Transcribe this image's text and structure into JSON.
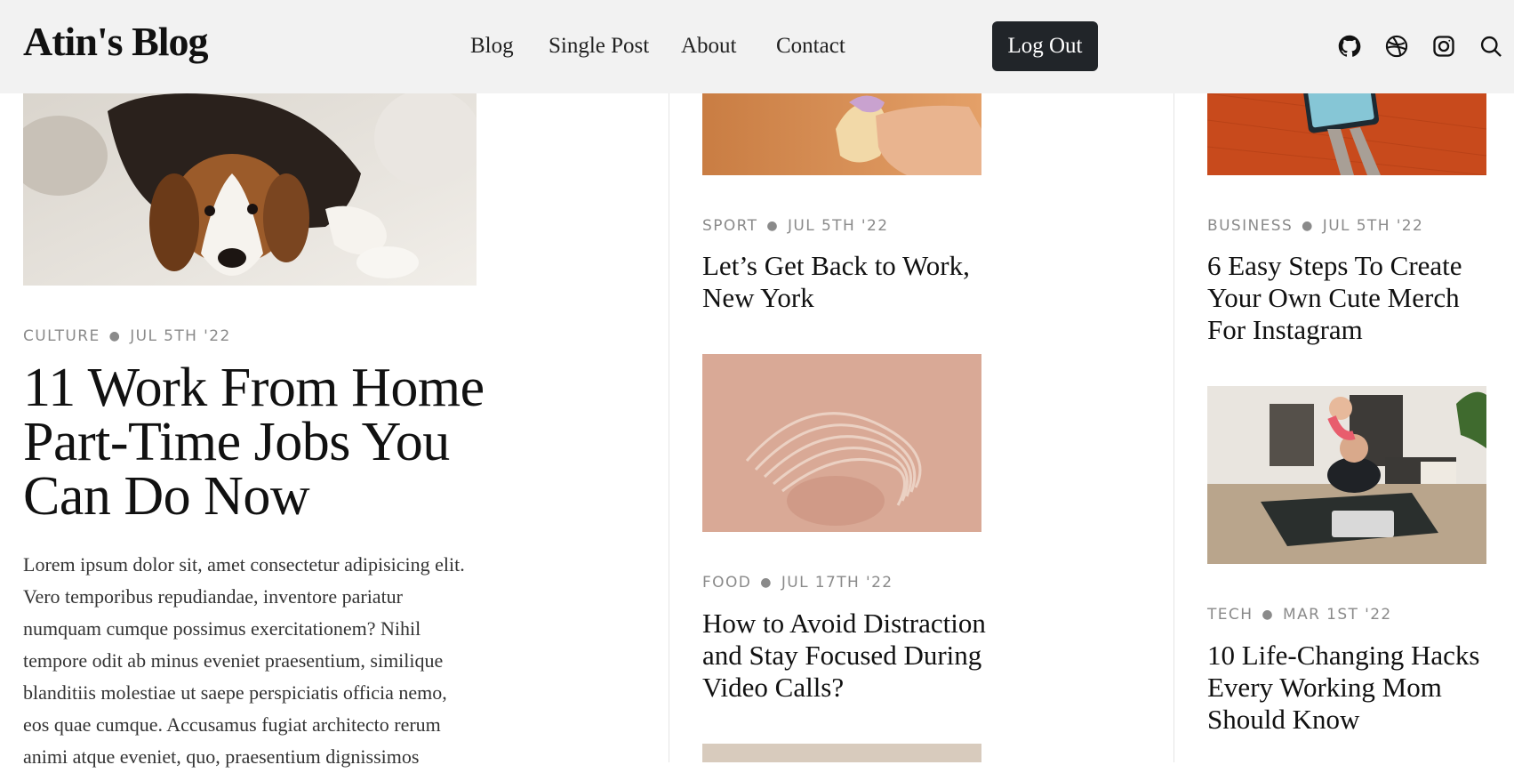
{
  "brand": "Atin's Blog",
  "nav": {
    "items": [
      "Blog",
      "Single Post",
      "About",
      "Contact"
    ],
    "logout_label": "Log Out"
  },
  "icons": [
    "github-icon",
    "dribbble-icon",
    "instagram-icon",
    "search-icon"
  ],
  "colors": {
    "header_bg": "#f2f2f2",
    "button_bg": "#212529",
    "meta_text": "#8a8a8a"
  },
  "featured": {
    "category": "CULTURE",
    "date": "JUL 5TH '22",
    "title": "11 Work From Home Part-Time Jobs You Can Do Now",
    "excerpt": "Lorem ipsum dolor sit, amet consectetur adipisicing elit. Vero temporibus repudiandae, inventore pariatur numquam cumque possimus exercitationem? Nihil tempore odit ab minus eveniet praesentium, similique blanditiis molestiae ut saepe perspiciatis officia nemo, eos quae cumque. Accusamus fugiat architecto rerum animi atque eveniet, quo, praesentium dignissimos"
  },
  "column2": [
    {
      "category": "SPORT",
      "date": "JUL 5TH '22",
      "title": "Let’s Get Back to Work, New York"
    },
    {
      "category": "FOOD",
      "date": "JUL 17TH '22",
      "title": "How to Avoid Distraction and Stay Focused During Video Calls?"
    }
  ],
  "column3": [
    {
      "category": "BUSINESS",
      "date": "JUL 5TH '22",
      "title": "6 Easy Steps To Create Your Own Cute Merch For Instagram"
    },
    {
      "category": "TECH",
      "date": "MAR 1ST '22",
      "title": "10 Life-Changing Hacks Every Working Mom Should Know"
    }
  ]
}
